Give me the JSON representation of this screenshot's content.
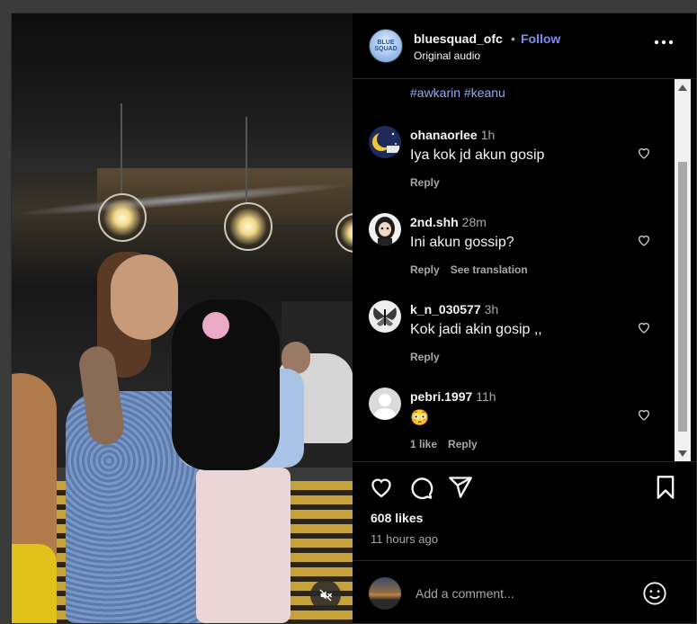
{
  "post": {
    "username": "bluesquad_ofc",
    "separator": "•",
    "follow_label": "Follow",
    "audio": "Original audio",
    "more_label": "•••",
    "avatar_text": "BLUE SQUAD",
    "hashtags": "#awkarin #keanu",
    "likes": "608 likes",
    "time_ago": "11 hours ago"
  },
  "comments": [
    {
      "username": "ohanaorlee",
      "time": "1h",
      "text": "Iya kok jd akun gosip",
      "actions": [
        "Reply"
      ],
      "avatar_icon": "moon-avatar"
    },
    {
      "username": "2nd.shh",
      "time": "28m",
      "text": "Ini akun gossip?",
      "actions": [
        "Reply",
        "See translation"
      ],
      "avatar_icon": "girl-avatar"
    },
    {
      "username": "k_n_030577",
      "time": "3h",
      "text": "Kok jadi akin gosip ,,",
      "actions": [
        "Reply"
      ],
      "avatar_icon": "butterfly-avatar"
    },
    {
      "username": "pebri.1997",
      "time": "11h",
      "text": "😳",
      "actions": [
        "1 like",
        "Reply"
      ],
      "avatar_icon": "default-avatar"
    }
  ],
  "composer": {
    "placeholder": "Add a comment..."
  },
  "colors": {
    "follow": "#7d8df7",
    "hashtag": "#94aaf2",
    "secondary_text": "#a8a8a8",
    "background": "#000000"
  }
}
